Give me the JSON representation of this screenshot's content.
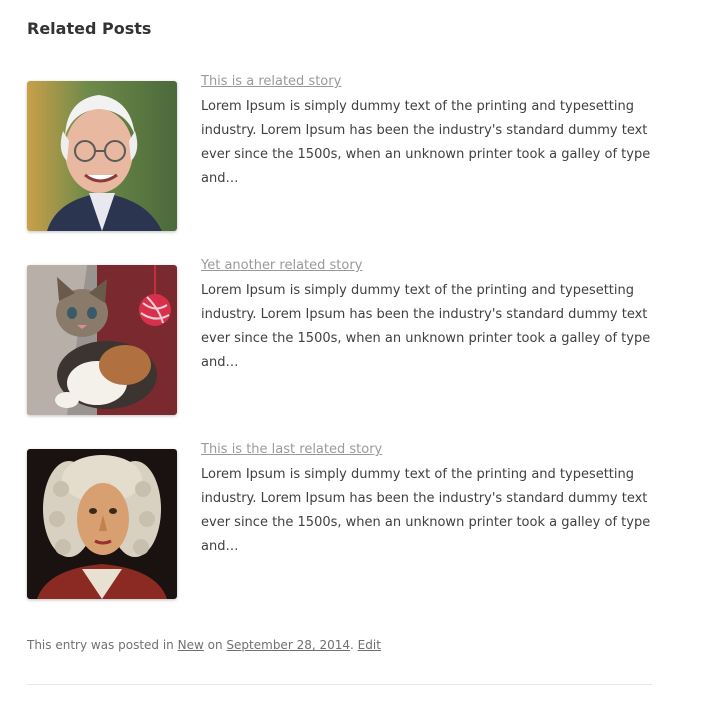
{
  "related": {
    "heading": "Related Posts",
    "posts": [
      {
        "title": "This is a related story",
        "excerpt": "Lorem Ipsum is simply dummy text of the printing and typesetting industry. Lorem Ipsum has been the industry's standard dummy text ever since the 1500s, when an unknown printer took a galley of type and…",
        "image": "elderly-man-portrait"
      },
      {
        "title": "Yet another related story",
        "excerpt": "Lorem Ipsum is simply dummy text of the printing and typesetting industry. Lorem Ipsum has been the industry's standard dummy text ever since the 1500s, when an unknown printer took a galley of type and…",
        "image": "kitten-photo"
      },
      {
        "title": "This is the last related story",
        "excerpt": "Lorem Ipsum is simply dummy text of the printing and typesetting industry. Lorem Ipsum has been the industry's standard dummy text ever since the 1500s, when an unknown printer took a galley of type and…",
        "image": "classical-portrait-painting"
      }
    ]
  },
  "entry_meta": {
    "prefix": "This entry was posted in",
    "category": "New",
    "on": "on",
    "date": "September 28, 2014",
    "separator": ".",
    "edit": "Edit"
  },
  "colors": {
    "link": "#9a9a9a",
    "text": "#404040",
    "meta": "#707070"
  }
}
